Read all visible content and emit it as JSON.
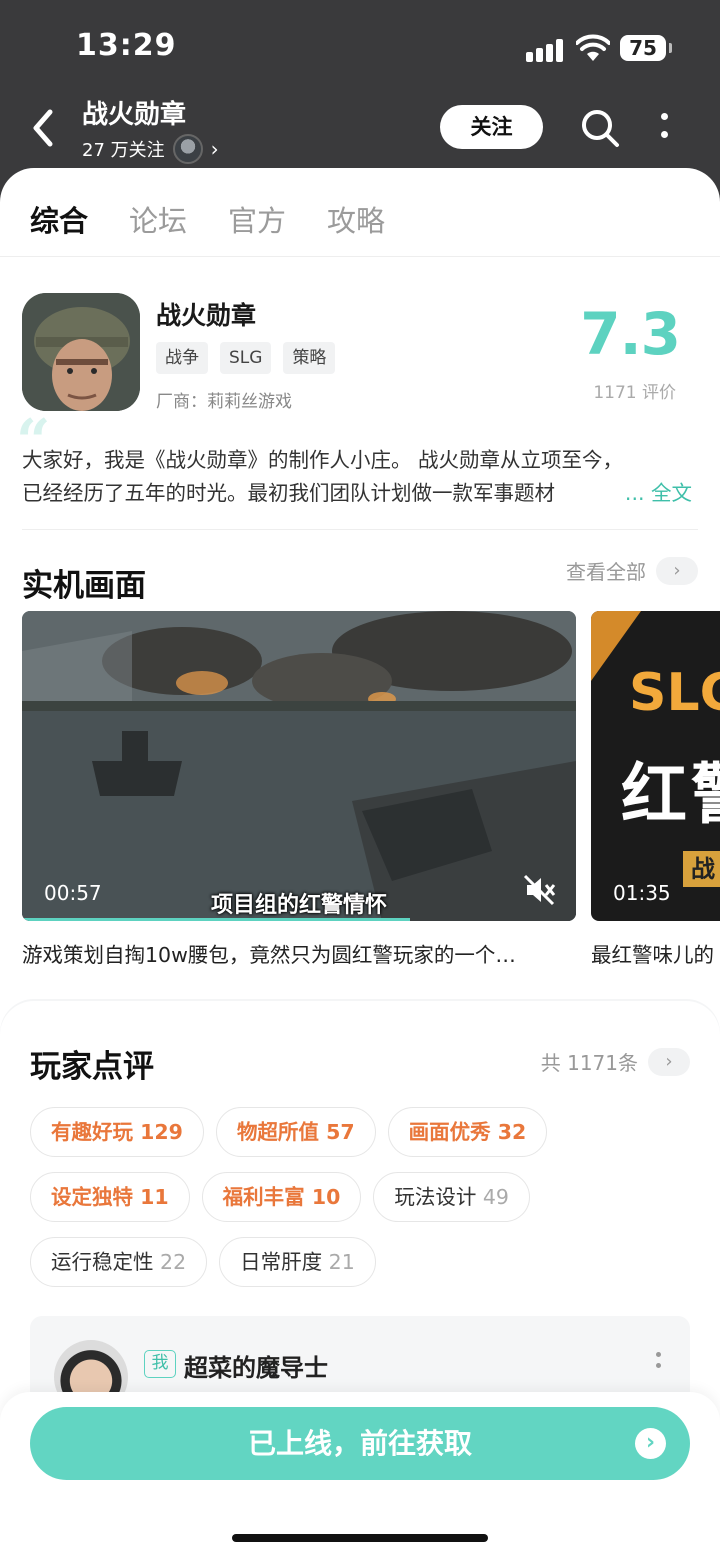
{
  "status": {
    "time": "13:29",
    "battery": "75"
  },
  "nav": {
    "title": "战火勋章",
    "followers": "27 万关注",
    "follow_label": "关注"
  },
  "tabs": [
    {
      "label": "综合",
      "active": true
    },
    {
      "label": "论坛"
    },
    {
      "label": "官方"
    },
    {
      "label": "攻略"
    }
  ],
  "app": {
    "name": "战火勋章",
    "tags": [
      "战争",
      "SLG",
      "策略"
    ],
    "vendor": "厂商：莉莉丝游戏",
    "score": "7.3",
    "rating_count": "1171 评价",
    "intro_line1": "大家好，我是《战火勋章》的制作人小庄。  战火勋章从立项至今，",
    "intro_line2": "已经经历了五年的时光。最初我们团队计划做一款军事题材",
    "intro_more": "... 全文"
  },
  "screens": {
    "title": "实机画面",
    "see_all": "查看全部",
    "videos": [
      {
        "duration": "00:57",
        "caption": "项目组的红警情怀",
        "title": "游戏策划自掏10w腰包，竟然只为圆红警玩家的一个…"
      },
      {
        "duration": "01:35",
        "overlay_top": "SLG",
        "overlay_mid": "红警",
        "overlay_small": "战",
        "title": "最红警味儿的"
      }
    ]
  },
  "reviews": {
    "title": "玩家点评",
    "total": "共 1171条",
    "chips": [
      [
        {
          "label": "有趣好玩",
          "count": "129",
          "hot": true
        },
        {
          "label": "物超所值",
          "count": "57",
          "hot": true
        },
        {
          "label": "画面优秀",
          "count": "32",
          "hot": true
        }
      ],
      [
        {
          "label": "设定独特",
          "count": "11",
          "hot": true
        },
        {
          "label": "福利丰富",
          "count": "10",
          "hot": true
        },
        {
          "label": "玩法设计",
          "count": "49",
          "hot": false
        }
      ],
      [
        {
          "label": "运行稳定性",
          "count": "22",
          "hot": false
        },
        {
          "label": "日常肝度",
          "count": "21",
          "hot": false
        }
      ]
    ],
    "first_review": {
      "badge": "我",
      "username": "超菜的魔导士"
    }
  },
  "cta": {
    "label": "已上线，前往获取"
  },
  "colors": {
    "accent": "#5dd2c0",
    "hot_tag": "#e9773b",
    "header_bg": "#3a3a3c"
  }
}
